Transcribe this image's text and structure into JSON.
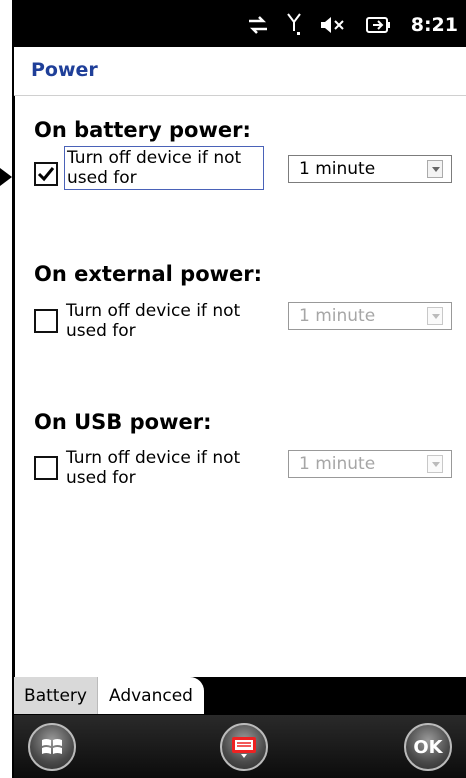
{
  "status": {
    "time": "8:21",
    "icons": [
      "connectivity-icon",
      "signal-icon",
      "volume-muted-icon",
      "battery-charging-icon"
    ]
  },
  "window": {
    "title": "Power"
  },
  "sections": [
    {
      "heading": "On battery power:",
      "checkbox_label": "Turn off device if not used for",
      "checked": true,
      "enabled": true,
      "dropdown_value": "1 minute"
    },
    {
      "heading": "On external power:",
      "checkbox_label": "Turn off device if not used for",
      "checked": false,
      "enabled": false,
      "dropdown_value": "1 minute"
    },
    {
      "heading": "On USB power:",
      "checkbox_label": "Turn off device if not used for",
      "checked": false,
      "enabled": false,
      "dropdown_value": "1 minute"
    }
  ],
  "tabs": [
    {
      "label": "Battery",
      "active": false
    },
    {
      "label": "Advanced",
      "active": true
    }
  ],
  "softkeys": {
    "start_icon": "windows-start-icon",
    "keyboard_icon": "keyboard-icon",
    "ok_label": "OK"
  },
  "colors": {
    "title": "#1f3f99",
    "status_bar": "#000000"
  }
}
